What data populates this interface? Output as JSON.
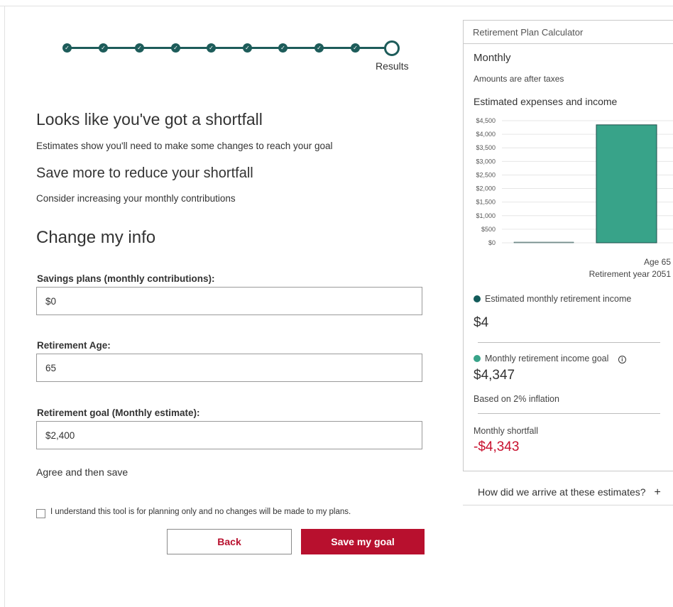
{
  "stepper": {
    "completed_steps": 9,
    "final_label": "Results",
    "accent": "#1d5c5a"
  },
  "main": {
    "shortfall_heading": "Looks like you've got a shortfall",
    "shortfall_sub": "Estimates show you'll need to make some changes to reach your goal",
    "save_more_heading": "Save more to reduce your shortfall",
    "save_more_sub": "Consider increasing your monthly contributions",
    "change_info_heading": "Change my info"
  },
  "form": {
    "savings_label": "Savings plans (monthly contributions):",
    "savings_value": "$0",
    "retirement_age_label": "Retirement Age:",
    "retirement_age_value": "65",
    "goal_label": "Retirement goal (Monthly estimate):",
    "goal_value": "$2,400",
    "agree_heading": "Agree and then save",
    "checkbox_label": "I understand this tool is for planning only and no changes will be made to my plans.",
    "checkbox_checked": false,
    "back_label": "Back",
    "save_label": "Save my goal"
  },
  "panel": {
    "title": "Retirement Plan Calculator",
    "period": "Monthly",
    "after_taxes": "Amounts are after taxes",
    "chart_heading": "Estimated expenses and income",
    "age_label": "Age 65",
    "retirement_year_label": "Retirement year 2051",
    "income_legend": "Estimated monthly retirement income",
    "income_value": "$4",
    "goal_legend": "Monthly retirement income goal",
    "goal_value": "$4,347",
    "inflation_note": "Based on 2% inflation",
    "shortfall_label": "Monthly shortfall",
    "shortfall_value": "-$4,343",
    "info_icon": "info-icon"
  },
  "colors": {
    "income": "#125b5a",
    "goal": "#38a389",
    "shortfall": "#c8102e",
    "brand": "#b8102e"
  },
  "how_link": "How did we arrive at these estimates?",
  "chart_data": {
    "type": "bar",
    "title": "Estimated expenses and income",
    "y_ticks": [
      "$4,500",
      "$4,000",
      "$3,500",
      "$3,000",
      "$2,500",
      "$2,000",
      "$1,500",
      "$1,000",
      "$500",
      "$0"
    ],
    "ylim": [
      0,
      4500
    ],
    "series": [
      {
        "name": "Estimated monthly retirement income",
        "values": [
          4
        ]
      },
      {
        "name": "Monthly retirement income goal",
        "values": [
          4347
        ]
      }
    ],
    "categories": [
      "Age 65"
    ],
    "grid": true
  }
}
